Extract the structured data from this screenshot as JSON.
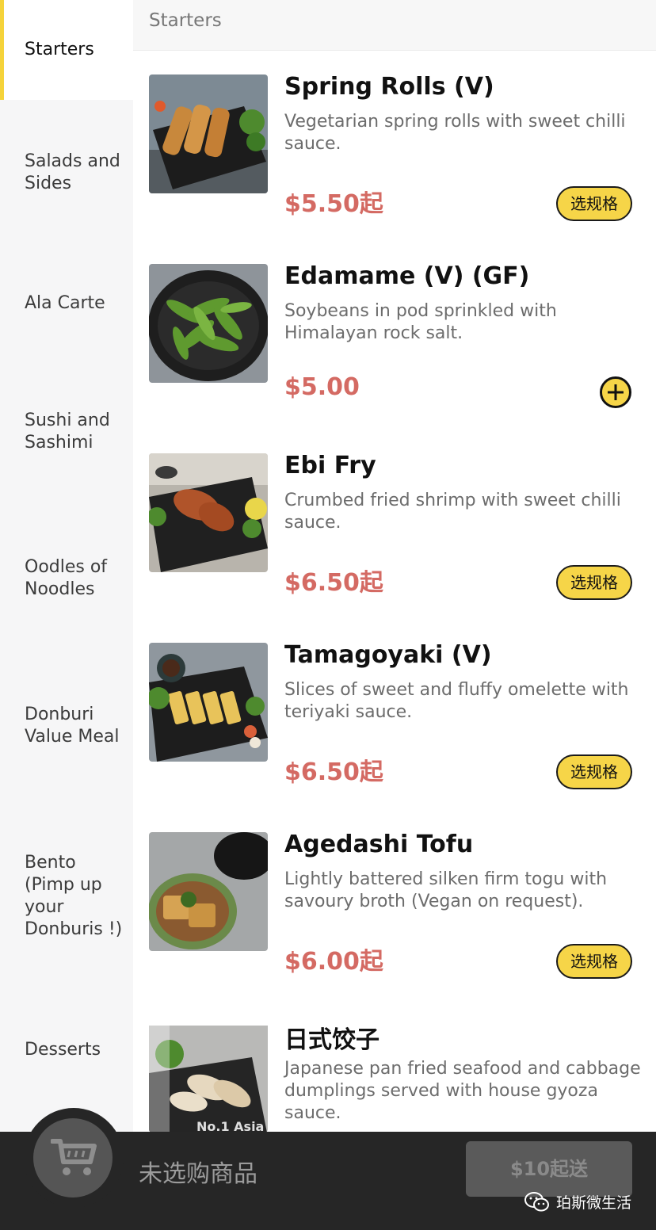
{
  "sidebar": {
    "categories": [
      {
        "label": "Starters"
      },
      {
        "label": "Salads and Sides"
      },
      {
        "label": "Ala Carte"
      },
      {
        "label": "Sushi and Sashimi"
      },
      {
        "label": "Oodles of Noodles"
      },
      {
        "label": "Donburi Value Meal"
      },
      {
        "label": "Bento (Pimp up your Donburis !)"
      },
      {
        "label": "Desserts"
      }
    ],
    "active_index": 0
  },
  "section": {
    "title": "Starters"
  },
  "items": [
    {
      "name": "Spring Rolls (V)",
      "description": "Vegetarian spring rolls with sweet chilli sauce.",
      "price": "$5.50起",
      "action": "选规格"
    },
    {
      "name": "Edamame (V) (GF)",
      "description": "Soybeans in pod sprinkled with Himalayan rock salt.",
      "price": "$5.00",
      "action": "add"
    },
    {
      "name": "Ebi Fry",
      "description": "Crumbed fried shrimp with sweet chilli sauce.",
      "price": "$6.50起",
      "action": "选规格"
    },
    {
      "name": "Tamagoyaki (V)",
      "description": "Slices of sweet and fluffy omelette with teriyaki sauce.",
      "price": "$6.50起",
      "action": "选规格"
    },
    {
      "name": "Agedashi Tofu",
      "description": "Lightly battered silken firm togu with savoury broth (Vegan on request).",
      "price": "$6.00起",
      "action": "选规格"
    },
    {
      "name": "日式饺子",
      "description": "Japanese pan fried seafood and cabbage dumplings served with house gyoza sauce.",
      "image_text": "No.1 Asia"
    }
  ],
  "cart": {
    "empty_text": "未选购商品",
    "min_order_label": "$10起送"
  },
  "watermark": {
    "text": "珀斯微生活"
  },
  "colors": {
    "accent": "#f6d548",
    "price": "#d46a63",
    "bar": "#262626"
  }
}
